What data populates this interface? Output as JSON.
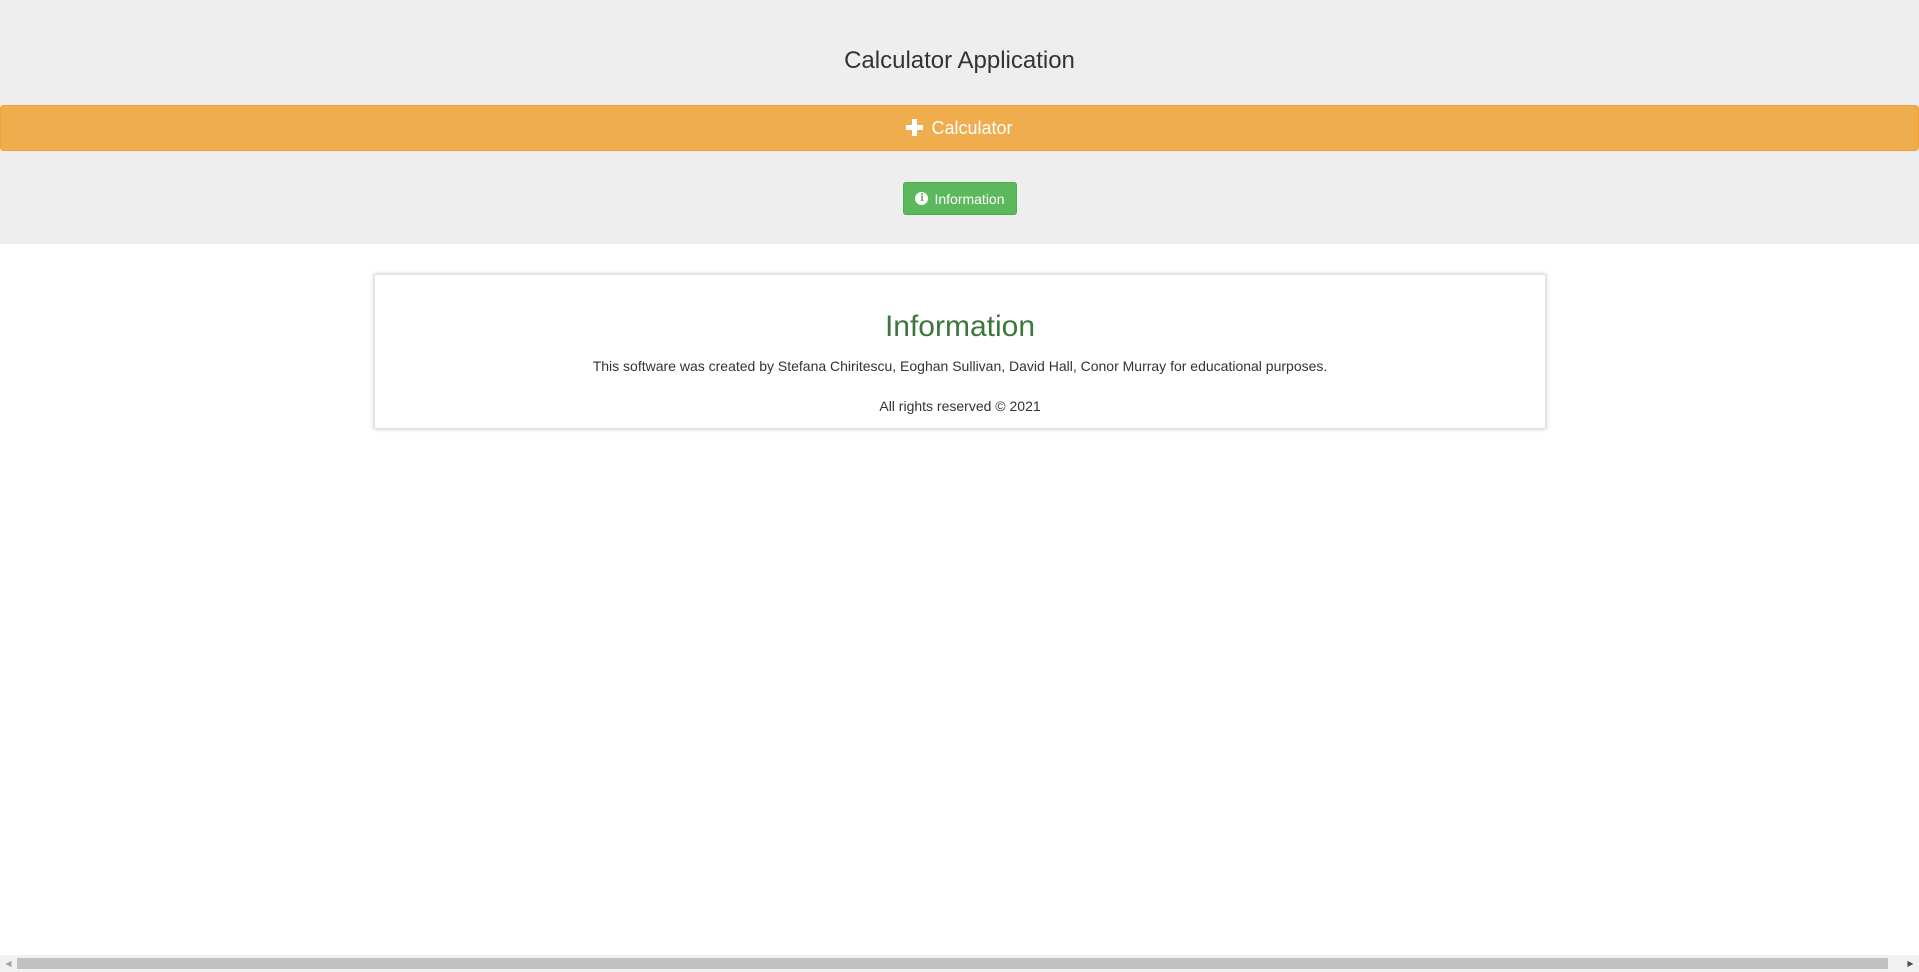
{
  "header": {
    "title": "Calculator Application",
    "calculator_label": "Calculator",
    "calculator_icon": "plus-icon",
    "information_label": "Information",
    "information_icon": "info-circle-icon"
  },
  "info_panel": {
    "title": "Information",
    "description": "This software was created by Stefana Chiritescu, Eoghan Sullivan, David Hall, Conor Murray for educational purposes.",
    "rights": "All rights reserved © 2021"
  },
  "colors": {
    "header_bg": "#eeeeee",
    "calculator_bar": "#f0ad4e",
    "information_button": "#5cb85c",
    "info_title": "#3c763d"
  },
  "scrollbar": {
    "left_arrow": "◀",
    "right_arrow": "▶"
  }
}
